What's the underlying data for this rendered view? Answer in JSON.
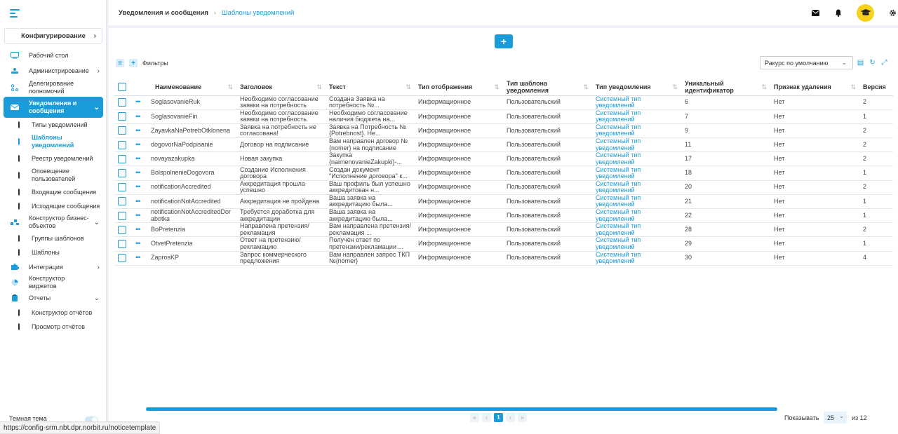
{
  "sidebar": {
    "configure_label": "Конфигурирование",
    "items": [
      {
        "label": "Рабочий стол"
      },
      {
        "label": "Администрирование"
      },
      {
        "label": "Делегирование полномочий"
      },
      {
        "label": "Уведомления и сообщения"
      },
      {
        "label": "Конструктор бизнес-объектов"
      },
      {
        "label": "Интеграция"
      },
      {
        "label": "Конструктор виджетов"
      },
      {
        "label": "Отчеты"
      }
    ],
    "notif_sub": [
      "Типы уведомлений",
      "Шаблоны уведомлений",
      "Реестр уведомлений",
      "Оповещение пользователей",
      "Входящие сообщения",
      "Исходящие сообщения"
    ],
    "bo_sub": [
      "Группы шаблонов",
      "Шаблоны"
    ],
    "reports_sub": [
      "Конструктор отчётов",
      "Просмотр отчётов"
    ],
    "theme_label": "Темная тема"
  },
  "header": {
    "breadcrumb_parent": "Уведомления и сообщения",
    "breadcrumb_current": "Шаблоны уведомлений"
  },
  "toolbar": {
    "add_label": "+",
    "filters_label": "Фильтры",
    "view_select": "Ракурс по умолчанию"
  },
  "table": {
    "columns": [
      "Наименование",
      "Заголовок",
      "Текст",
      "Тип отображения",
      "Тип шаблона уведомления",
      "Тип уведомления",
      "Уникальный идентификатор",
      "Признак удаления",
      "Версия"
    ],
    "rows": [
      [
        "SoglasovanieRuk",
        "Необходимо согласование заявки на потребность",
        "Создана Заявка на потребность №...",
        "Информационное",
        "Пользовательский",
        "Системный тип уведомлений",
        "6",
        "Нет",
        "2"
      ],
      [
        "SoglasovanieFin",
        "Необходимо согласование заявки на потребность",
        "Необходимо согласование наличия бюджета на...",
        "Информационное",
        "Пользовательский",
        "Системный тип уведомлений",
        "7",
        "Нет",
        "1"
      ],
      [
        "ZayavkaNaPotrebOtklonena",
        "Заявка на потребность не согласована!",
        "Заявка на Потребность № {Potrebnost}. Не...",
        "Информационное",
        "Пользовательский",
        "Системный тип уведомлений",
        "9",
        "Нет",
        "2"
      ],
      [
        "dogovorNaPodpisanie",
        "Договор на подписание",
        "Вам направлен договор № {nomer} на подписание",
        "Информационное",
        "Пользовательский",
        "Системный тип уведомлений",
        "11",
        "Нет",
        "2"
      ],
      [
        "novayazakupka",
        "Новая закупка",
        "Закупка {naimenovanieZakupki}-...",
        "Информационное",
        "Пользовательский",
        "Системный тип уведомлений",
        "17",
        "Нет",
        "2"
      ],
      [
        "BolspolnenieDogovora",
        "Создание Исполнения договора",
        "Создан документ \"Исполнение договора\" к...",
        "Информационное",
        "Пользовательский",
        "Системный тип уведомлений",
        "18",
        "Нет",
        "1"
      ],
      [
        "notificationAccredited",
        "Аккредитация прошла успешно",
        "Ваш профиль был успешно аккредитован н...",
        "Информационное",
        "Пользовательский",
        "Системный тип уведомлений",
        "20",
        "Нет",
        "2"
      ],
      [
        "notificationNotAccredited",
        "Аккредитация не пройдена",
        "Ваша заявка на аккредитацию была...",
        "Информационное",
        "Пользовательский",
        "Системный тип уведомлений",
        "21",
        "Нет",
        "1"
      ],
      [
        "notificationNotAccreditedDorabotka",
        "Требуется доработка для аккредитации",
        "Ваша заявка на аккредитацию была...",
        "Информационное",
        "Пользовательский",
        "Системный тип уведомлений",
        "22",
        "Нет",
        "1"
      ],
      [
        "BoPretenzia",
        "Направлена претензия/рекламация",
        "Вам направлена претензия/рекламация ...",
        "Информационное",
        "Пользовательский",
        "Системный тип уведомлений",
        "28",
        "Нет",
        "2"
      ],
      [
        "OtvetPretenzia",
        "Ответ на претензию/рекламацию",
        "Получен ответ по претензии/рекламации ...",
        "Информационное",
        "Пользовательский",
        "Системный тип уведомлений",
        "29",
        "Нет",
        "1"
      ],
      [
        "ZaprosKP",
        "Запрос коммерческого предложения",
        "Вам направлен запрос ТКП №{nomer}",
        "Информационное",
        "Пользовательский",
        "Системный тип уведомлений",
        "30",
        "Нет",
        "4"
      ]
    ]
  },
  "pagination": {
    "prev_first": "«",
    "prev": "‹",
    "current": "1",
    "next": "›",
    "next_last": "»",
    "show_label": "Показывать",
    "per_page": "25",
    "of_label": "из 12"
  },
  "status_url": "https://config-srm.nbt.dpr.norbit.ru/noticetemplate",
  "colors": {
    "accent": "#1a9cdb",
    "avatar": "#f7d21b"
  }
}
